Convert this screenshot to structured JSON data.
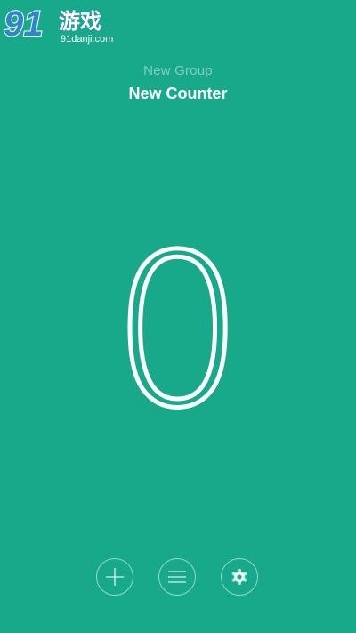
{
  "watermark": {
    "logo_number": "91",
    "logo_text": "游戏",
    "site": "91danji.com"
  },
  "header": {
    "group_name": "New Group",
    "counter_name": "New Counter"
  },
  "counter": {
    "value": "0"
  },
  "toolbar": {
    "buttons": [
      {
        "name": "add",
        "icon": "plus-icon"
      },
      {
        "name": "menu",
        "icon": "menu-icon"
      },
      {
        "name": "settings",
        "icon": "gear-icon"
      }
    ]
  },
  "colors": {
    "background": "#17a98a",
    "foreground": "#ffffff",
    "watermark_blue": "#2f86c8"
  }
}
